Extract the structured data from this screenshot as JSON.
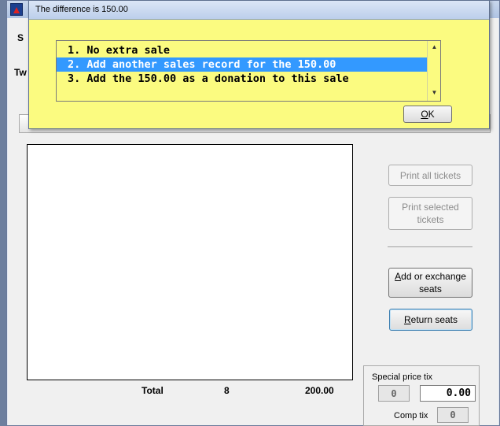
{
  "background_window": {
    "label_s": "S",
    "label_tw": "Tw",
    "print_all_label": "Print all tickets",
    "print_selected_label": "Print selected tickets",
    "add_exchange_label": "Add or exchange seats",
    "return_seats_label": "Return seats",
    "total": {
      "label": "Total",
      "count": "8",
      "amount": "200.00"
    },
    "special_price": {
      "label": "Special price tix",
      "count": "0",
      "amount": "0.00",
      "comp_label": "Comp tix",
      "comp_count": "0"
    }
  },
  "dialog": {
    "title": "The difference is 150.00",
    "options": [
      "1. No extra sale",
      "2. Add another sales record for the 150.00",
      "3. Add the 150.00 as a donation to this sale"
    ],
    "selected_index": 1,
    "ok_label": "OK"
  },
  "colors": {
    "dialog_bg": "#fbfb80",
    "selection": "#3399ff"
  },
  "icons": {
    "app": "app-logo-icon",
    "scroll_up": "scroll-up-arrow-icon",
    "scroll_down": "scroll-down-arrow-icon"
  }
}
